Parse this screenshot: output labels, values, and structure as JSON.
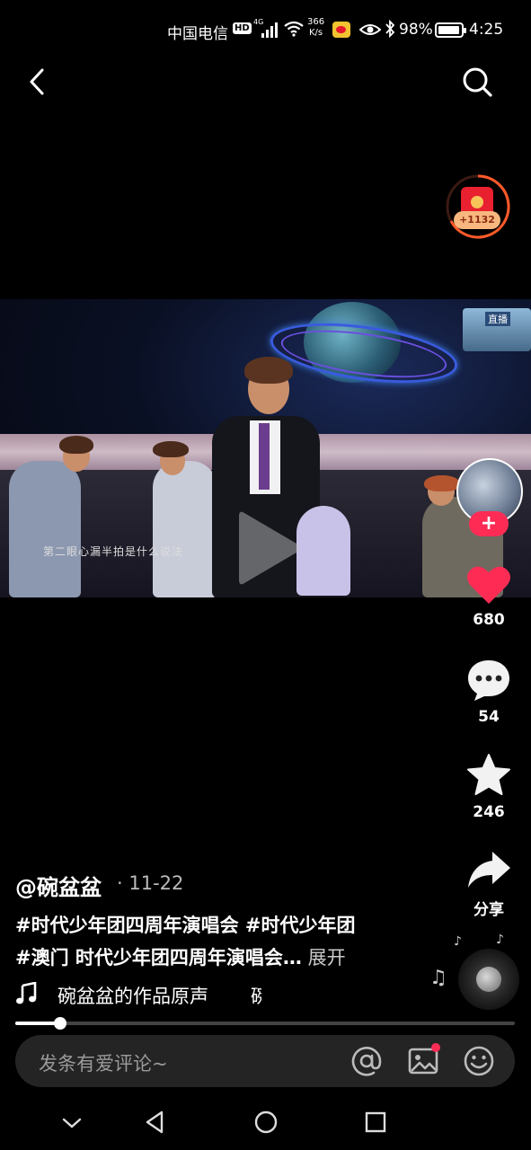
{
  "status_bar": {
    "carrier": "中国电信",
    "hd": "HD",
    "network": "4G",
    "speed_value": "366",
    "speed_unit": "K/s",
    "battery_percent": "98%",
    "time": "4:25"
  },
  "nav": {
    "back_icon": "chevron-left-icon",
    "search_icon": "search-icon"
  },
  "reward": {
    "badge": "+1132",
    "icon": "red-envelope-icon",
    "accent": "#ff5a2a"
  },
  "video": {
    "subtitle": "第二眼心漏半拍是什么说法",
    "screen_tag": "直播",
    "play_icon": "play-icon"
  },
  "actions": {
    "follow_label": "+",
    "likes": "680",
    "comments": "54",
    "favorites": "246",
    "share_label": "分享",
    "like_color": "#fe2c55"
  },
  "post": {
    "author": "@碗盆盆",
    "date": "· 11-22",
    "caption_line1": "#时代少年团四周年演唱会 #时代少年团",
    "caption_line2": "#澳门 时代少年团四周年演唱会…",
    "expand": " 展开",
    "music": "碗盆盆的作品原声",
    "music_tail": "碗"
  },
  "progress": {
    "fraction": 0.09
  },
  "comment_bar": {
    "placeholder": "发条有爱评论~",
    "icons": [
      "at-icon",
      "image-icon",
      "emoji-icon"
    ]
  },
  "system_nav": {
    "icons": [
      "chevron-down-icon",
      "back-triangle-icon",
      "home-circle-icon",
      "recents-square-icon"
    ]
  }
}
